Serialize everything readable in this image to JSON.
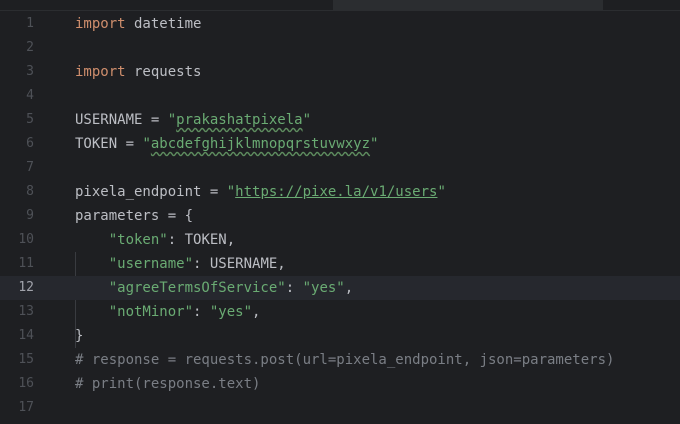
{
  "editor": {
    "lines": [
      {
        "num": "1",
        "tokens": [
          {
            "t": "import",
            "c": "kw"
          },
          {
            "t": " datetime",
            "c": ""
          }
        ]
      },
      {
        "num": "2",
        "tokens": []
      },
      {
        "num": "3",
        "tokens": [
          {
            "t": "import",
            "c": "kw"
          },
          {
            "t": " requests",
            "c": ""
          }
        ]
      },
      {
        "num": "4",
        "tokens": []
      },
      {
        "num": "5",
        "tokens": [
          {
            "t": "USERNAME = ",
            "c": ""
          },
          {
            "t": "\"",
            "c": "str"
          },
          {
            "t": "prakashatpixela",
            "c": "str typo"
          },
          {
            "t": "\"",
            "c": "str"
          }
        ]
      },
      {
        "num": "6",
        "tokens": [
          {
            "t": "TOKEN = ",
            "c": ""
          },
          {
            "t": "\"",
            "c": "str"
          },
          {
            "t": "abcdefghijklmnopqrstuvwxyz",
            "c": "str typo"
          },
          {
            "t": "\"",
            "c": "str"
          }
        ]
      },
      {
        "num": "7",
        "tokens": []
      },
      {
        "num": "8",
        "tokens": [
          {
            "t": "pixela_endpoint = ",
            "c": ""
          },
          {
            "t": "\"",
            "c": "str"
          },
          {
            "t": "https://pixe.la/v1/users",
            "c": "url"
          },
          {
            "t": "\"",
            "c": "str"
          }
        ]
      },
      {
        "num": "9",
        "tokens": [
          {
            "t": "parameters = {",
            "c": ""
          }
        ]
      },
      {
        "num": "10",
        "tokens": [
          {
            "t": "    ",
            "c": ""
          },
          {
            "t": "\"token\"",
            "c": "str"
          },
          {
            "t": ": TOKEN,",
            "c": ""
          }
        ]
      },
      {
        "num": "11",
        "tokens": [
          {
            "t": "    ",
            "c": ""
          },
          {
            "t": "\"username\"",
            "c": "str"
          },
          {
            "t": ": USERNAME,",
            "c": ""
          }
        ]
      },
      {
        "num": "12",
        "current": true,
        "tokens": [
          {
            "t": "    ",
            "c": ""
          },
          {
            "t": "\"agreeTermsOfService\"",
            "c": "str"
          },
          {
            "t": ": ",
            "c": ""
          },
          {
            "t": "\"yes\"",
            "c": "str"
          },
          {
            "t": ",",
            "c": ""
          }
        ]
      },
      {
        "num": "13",
        "tokens": [
          {
            "t": "    ",
            "c": ""
          },
          {
            "t": "\"notMinor\"",
            "c": "str"
          },
          {
            "t": ": ",
            "c": ""
          },
          {
            "t": "\"yes\"",
            "c": "str"
          },
          {
            "t": ",",
            "c": ""
          }
        ]
      },
      {
        "num": "14",
        "tokens": [
          {
            "t": "}",
            "c": ""
          }
        ]
      },
      {
        "num": "15",
        "tokens": [
          {
            "t": "# response = requests.post(url=pixela_endpoint, json=parameters)",
            "c": "cmt"
          }
        ]
      },
      {
        "num": "16",
        "tokens": [
          {
            "t": "# print(response.text)",
            "c": "cmt"
          }
        ]
      },
      {
        "num": "17",
        "tokens": []
      }
    ]
  }
}
